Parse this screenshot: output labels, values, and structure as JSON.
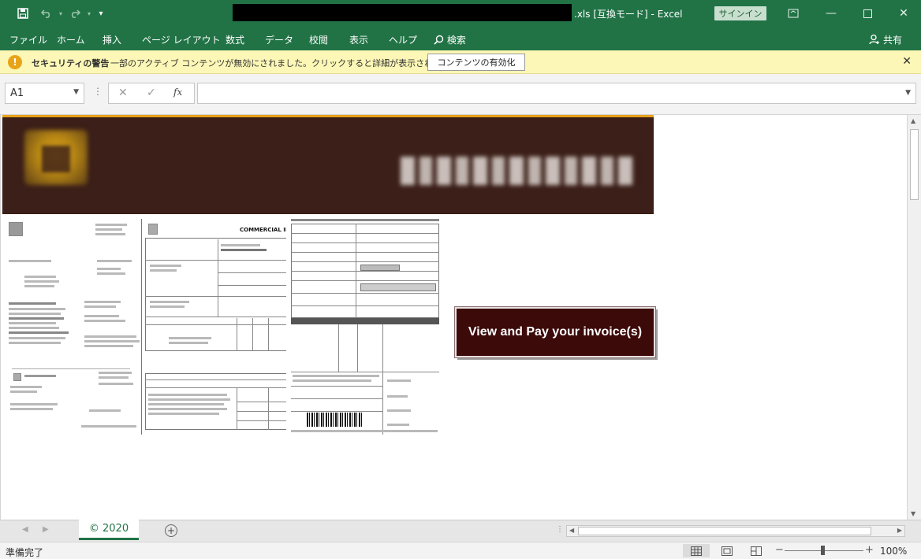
{
  "titlebar": {
    "file_suffix": ".xls",
    "mode": "[互換モード]",
    "separator": "-",
    "app_name": "Excel",
    "signin_label": "サインイン"
  },
  "ribbon": {
    "tabs": [
      "ファイル",
      "ホーム",
      "挿入",
      "ページ レイアウト",
      "数式",
      "データ",
      "校閲",
      "表示",
      "ヘルプ"
    ],
    "search_label": "検索",
    "share_label": "共有"
  },
  "security_bar": {
    "title": "セキュリティの警告",
    "message": "一部のアクティブ コンテンツが無効にされました。クリックすると詳細が表示されます。",
    "enable_button": "コンテンツの有効化"
  },
  "formula_bar": {
    "name_box": "A1",
    "fx_label": "fx"
  },
  "sheet": {
    "documents": {
      "commercial_invoice_title": "COMMERCIAL INVOICE"
    },
    "pay_button_label": "View and Pay your invoice(s)"
  },
  "sheet_tabs": {
    "active_tab": "© 2020"
  },
  "status_bar": {
    "status": "準備完了",
    "zoom": "100%"
  },
  "colors": {
    "excel_green": "#217346",
    "security_bar": "#fcf7b6",
    "banner_bg": "#3b1f18",
    "banner_accent": "#e7a11a",
    "pay_button": "#3d0a0a"
  },
  "icons": {
    "save": "save-icon",
    "undo": "undo-icon",
    "redo": "redo-icon",
    "warning": "warning-icon",
    "search": "search-icon",
    "share": "person-icon"
  }
}
